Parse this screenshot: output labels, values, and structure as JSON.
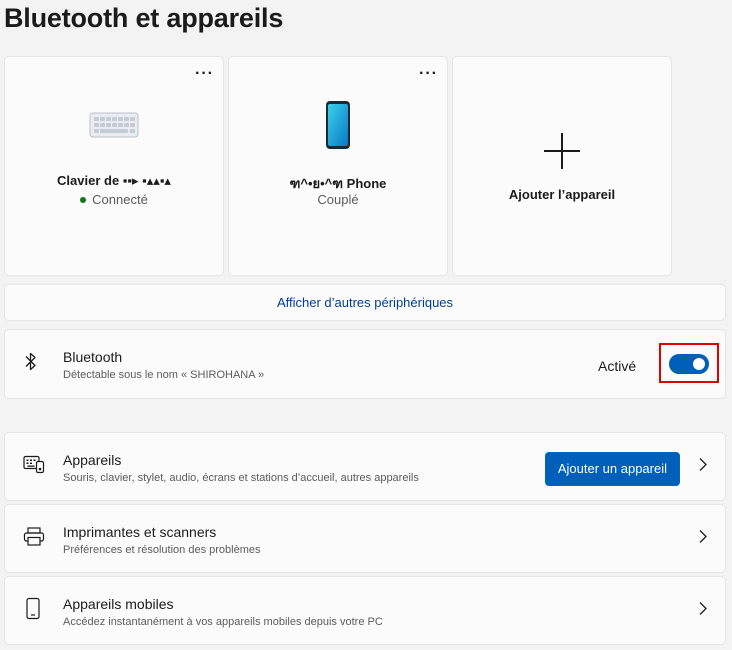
{
  "page": {
    "title": "Bluetooth et appareils"
  },
  "devices": [
    {
      "name": "Clavier de ▪▪▸ ▪▴▴▪▴",
      "status": "Connecté",
      "connected": true,
      "icon": "keyboard-icon"
    },
    {
      "name": "ฑ^•ย•^ฑ Phone",
      "status": "Couplé",
      "connected": false,
      "icon": "phone-icon"
    }
  ],
  "add_device_card": {
    "label": "Ajouter l’appareil",
    "icon": "plus-icon"
  },
  "more_options_label": "···",
  "show_more_link": "Afficher d’autres périphériques",
  "bluetooth": {
    "title": "Bluetooth",
    "subtitle": "Détectable sous le nom « SHIROHANA »",
    "state_label": "Activé",
    "enabled": true,
    "icon": "bluetooth-icon"
  },
  "settings": [
    {
      "title": "Appareils",
      "subtitle": "Souris, clavier, stylet, audio, écrans et stations d’accueil, autres appareils",
      "icon": "devices-icon",
      "button": "Ajouter un appareil"
    },
    {
      "title": "Imprimantes et scanners",
      "subtitle": "Préférences et résolution des problèmes",
      "icon": "printer-icon"
    },
    {
      "title": "Appareils mobiles",
      "subtitle": "Accédez instantanément à vos appareils mobiles depuis votre PC",
      "icon": "mobile-device-icon"
    }
  ],
  "colors": {
    "accent": "#005fb8",
    "highlight": "#e00000",
    "connected": "#0f7b0f",
    "link": "#003e92"
  }
}
